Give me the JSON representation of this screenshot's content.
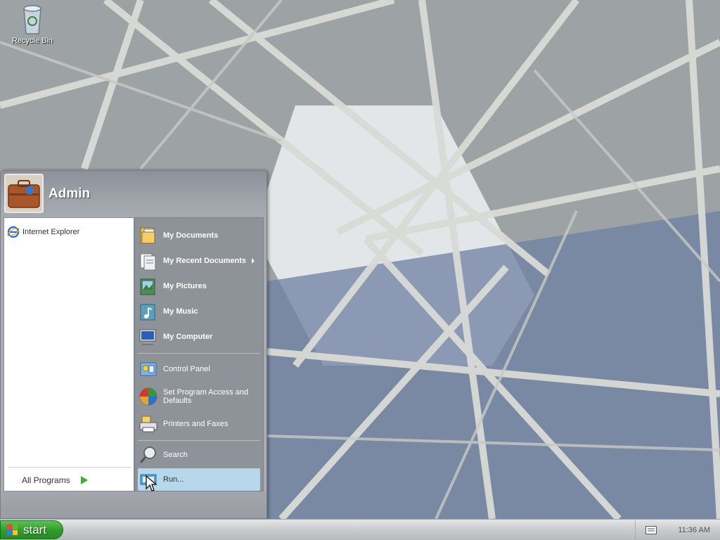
{
  "desktop": {
    "icons": [
      {
        "label": "Recycle Bin",
        "icon": "recycle-bin-icon"
      }
    ]
  },
  "start_menu": {
    "user_name": "Admin",
    "pinned": [
      {
        "label": "Internet Explorer",
        "icon": "internet-explorer-icon"
      }
    ],
    "all_programs_label": "All Programs",
    "places": [
      {
        "label": "My Documents",
        "icon": "my-documents-icon"
      },
      {
        "label": "My Recent Documents",
        "icon": "recent-documents-icon",
        "submenu": true
      },
      {
        "label": "My Pictures",
        "icon": "my-pictures-icon"
      },
      {
        "label": "My Music",
        "icon": "my-music-icon"
      },
      {
        "label": "My Computer",
        "icon": "my-computer-icon"
      }
    ],
    "settings": [
      {
        "label": "Control Panel",
        "icon": "control-panel-icon"
      },
      {
        "label": "Set Program Access and Defaults",
        "icon": "program-access-icon"
      },
      {
        "label": "Printers and Faxes",
        "icon": "printers-faxes-icon"
      }
    ],
    "tools": [
      {
        "label": "Search",
        "icon": "search-icon"
      },
      {
        "label": "Run...",
        "icon": "run-icon",
        "highlighted": true
      }
    ]
  },
  "taskbar": {
    "start_label": "start",
    "clock": "11:36 AM",
    "tray_icon": "keyboard-icon"
  },
  "colors": {
    "start_button": "#2f9b2a",
    "menu_pane": "#8e939a",
    "highlight": "#b7d7ea"
  }
}
